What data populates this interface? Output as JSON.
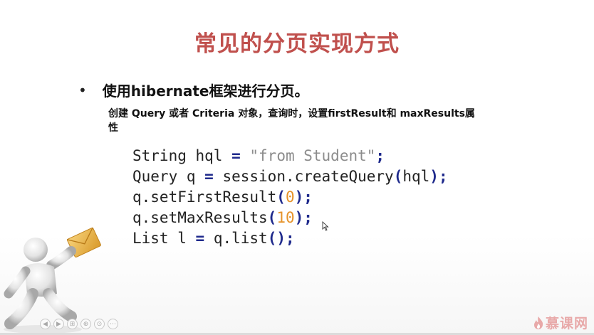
{
  "slide": {
    "title": "常见的分页实现方式",
    "bullet": "使用hibernate框架进行分页。",
    "subtext": "创建  Query 或者 Criteria 对象，查询时，设置firstResult和 maxResults属性"
  },
  "code": {
    "line1": {
      "a": "String hql ",
      "b": "=",
      "c": " ",
      "d": "\"from Student\"",
      "e": ";"
    },
    "line2": {
      "a": "Query q ",
      "b": "=",
      "c": " session.createQuery",
      "d": "(",
      "e": "hql",
      "f": ")",
      "g": ";"
    },
    "line3": {
      "a": "q.setFirstResult",
      "b": "(",
      "c": "0",
      "d": ")",
      "e": ";"
    },
    "line4": {
      "a": "q.setMaxResults",
      "b": "(",
      "c": "10",
      "d": ")",
      "e": ";"
    },
    "line5": {
      "a": "List l ",
      "b": "=",
      "c": " q.list",
      "d": "()",
      "e": ";"
    }
  },
  "icons": {
    "figure": "person-holding-envelope-icon",
    "cursor": "mouse-cursor-icon",
    "logo": "flame-logo-icon"
  },
  "player_controls": [
    "◀",
    "▶",
    "⊞",
    "⊕",
    "⊙",
    "⋯"
  ],
  "logo_text": "慕课网",
  "colors": {
    "title": "#c0504d",
    "keyword": "#1f2a8c",
    "string": "#8c8c8c",
    "number": "#e6932a"
  }
}
